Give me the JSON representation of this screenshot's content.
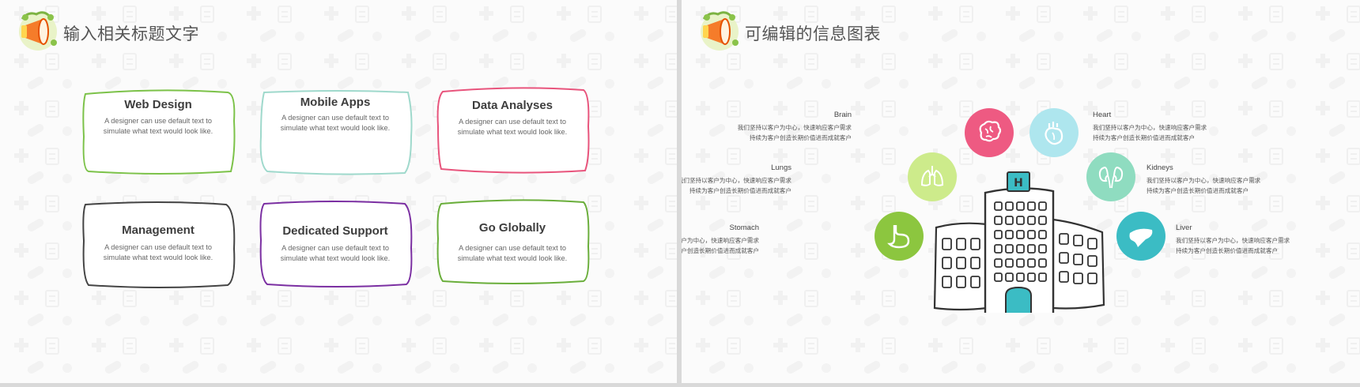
{
  "colors": {
    "background": "#fbfbfb",
    "card_green": "#7cc249",
    "card_teal": "#9fd9cc",
    "card_pink": "#e8547c",
    "card_dark": "#444444",
    "card_purple": "#7b2fa2",
    "card_olive": "#6aae3b"
  },
  "slide1": {
    "title": "输入相关标题文字",
    "cards": [
      {
        "title": "Web Design",
        "line1": "A designer can use default text to",
        "line2": "simulate what text would look like."
      },
      {
        "title": "Mobile Apps",
        "line1": "A designer can use default text to",
        "line2": "simulate what text would look like."
      },
      {
        "title": "Data Analyses",
        "line1": "A designer can use default text to",
        "line2": "simulate what text would look like."
      },
      {
        "title": "Management",
        "line1": "A designer can use default text to",
        "line2": "simulate what text would look like."
      },
      {
        "title": "Dedicated Support",
        "line1": "A designer can use default text to",
        "line2": "simulate what text would look like."
      },
      {
        "title": "Go Globally",
        "line1": "A designer can use default text to",
        "line2": "simulate what text would look like."
      }
    ]
  },
  "slide2": {
    "title": "可编辑的信息图表",
    "organs": [
      {
        "label": "Brain",
        "line1": "我们坚持以客户为中心，快速响应客户需求",
        "line2": "持续为客户创造长期价值进而成就客户",
        "color": "#ee5a82",
        "icon": "brain-icon"
      },
      {
        "label": "Heart",
        "line1": "我们坚持以客户为中心，快速响应客户需求",
        "line2": "持续为客户创造长期价值进而成就客户",
        "color": "#aee6ee",
        "icon": "heart-icon"
      },
      {
        "label": "Lungs",
        "line1": "我们坚持以客户为中心，快速响应客户需求",
        "line2": "持续为客户创造长期价值进而成就客户",
        "color": "#cdeb8b",
        "icon": "lungs-icon"
      },
      {
        "label": "Kidneys",
        "line1": "我们坚持以客户为中心，快速响应客户需求",
        "line2": "持续为客户创造长期价值进而成就客户",
        "color": "#8fdcc0",
        "icon": "kidneys-icon"
      },
      {
        "label": "Stomach",
        "line1": "我们坚持以客户为中心，快速响应客户需求",
        "line2": "持续为客户创造长期价值进而成就客户",
        "color": "#8cc63f",
        "icon": "stomach-icon"
      },
      {
        "label": "Liver",
        "line1": "我们坚持以客户为中心，快速响应客户需求",
        "line2": "持续为客户创造长期价值进而成就客户",
        "color": "#3bbcc4",
        "icon": "liver-icon"
      }
    ],
    "hospital_sign": "H"
  }
}
